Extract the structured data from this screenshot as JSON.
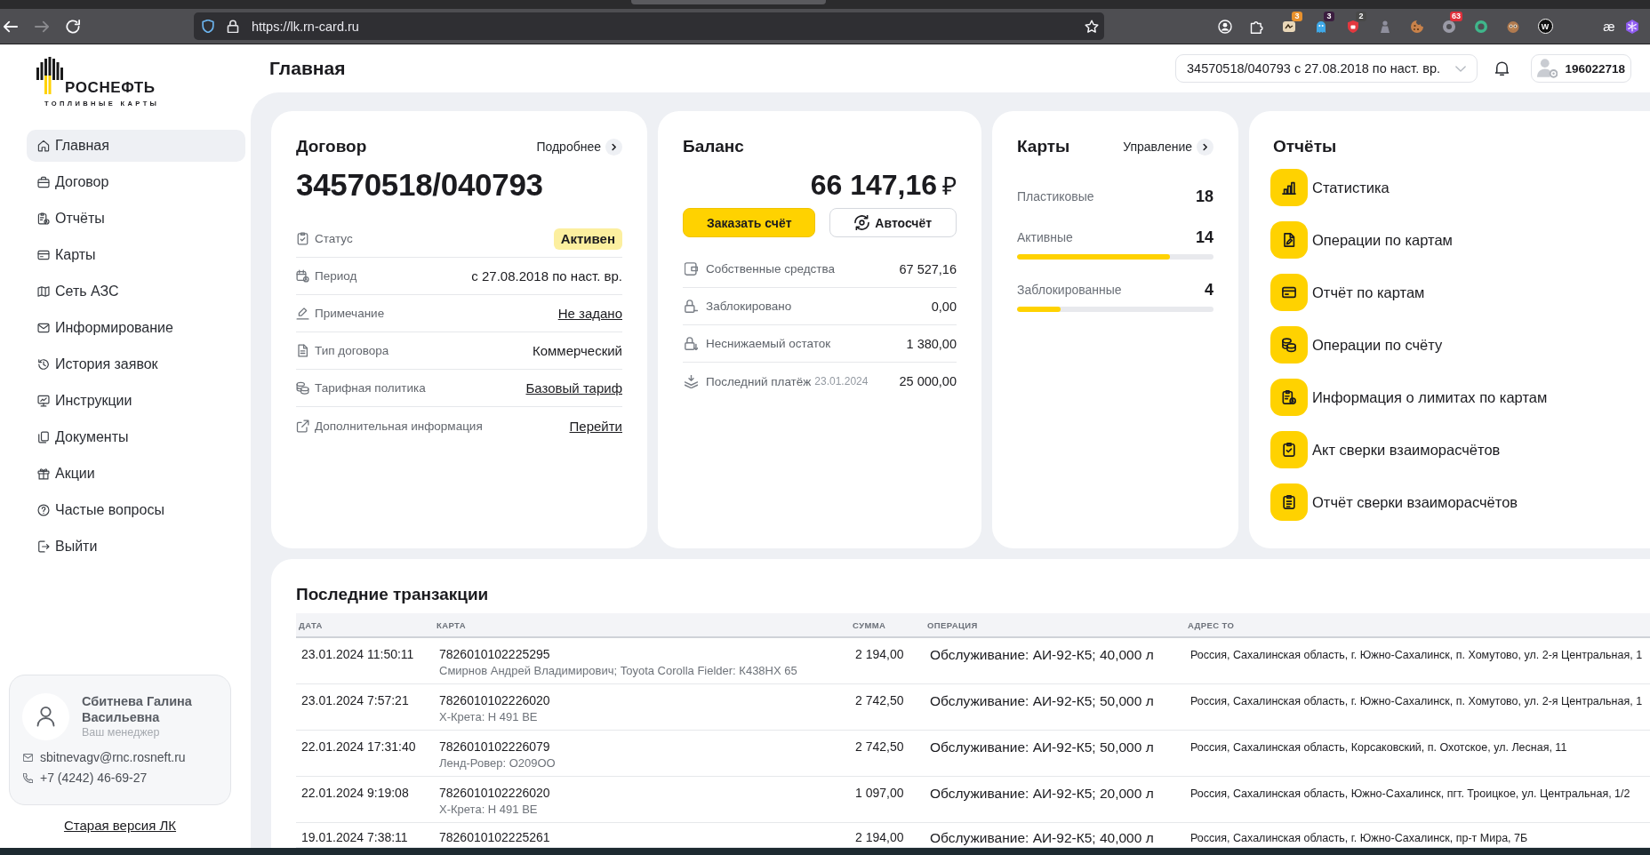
{
  "browser": {
    "url": "https://lk.rn-card.ru",
    "badges": [
      {
        "text": "3",
        "color": "#e8912d"
      },
      {
        "text": "3",
        "color": "#3b1d3f"
      },
      {
        "text": "2",
        "color": "#484848"
      },
      {
        "text": "63",
        "color": "#e0303b"
      }
    ],
    "letter_buttons": [
      "W",
      "æ"
    ]
  },
  "logo": {
    "name": "РОСНЕФТЬ",
    "tagline": "ТОПЛИВНЫЕ КАРТЫ"
  },
  "header": {
    "title": "Главная",
    "contract_selector": "34570518/040793 с 27.08.2018 по наст. вр.",
    "user_id": "196022718"
  },
  "sidebar": {
    "items": [
      {
        "label": "Главная",
        "selected": true
      },
      {
        "label": "Договор",
        "selected": false
      },
      {
        "label": "Отчёты",
        "selected": false
      },
      {
        "label": "Карты",
        "selected": false
      },
      {
        "label": "Сеть АЗС",
        "selected": false
      },
      {
        "label": "Информирование",
        "selected": false
      },
      {
        "label": "История заявок",
        "selected": false
      },
      {
        "label": "Инструкции",
        "selected": false
      },
      {
        "label": "Документы",
        "selected": false
      },
      {
        "label": "Акции",
        "selected": false
      },
      {
        "label": "Частые вопросы",
        "selected": false
      },
      {
        "label": "Выйти",
        "selected": false
      }
    ],
    "manager": {
      "name": "Сбитнева Галина Васильевна",
      "role": "Ваш менеджер",
      "email": "sbitnevagv@rnc.rosneft.ru",
      "phone": "+7 (4242) 46-69-27"
    },
    "old_version_link": "Старая версия ЛК"
  },
  "contract": {
    "title": "Договор",
    "details_link": "Подробнее",
    "number": "34570518/040793",
    "rows": [
      {
        "label": "Статус",
        "value": "Активен",
        "kind": "badge"
      },
      {
        "label": "Период",
        "value": "с 27.08.2018 по наст. вр.",
        "kind": "text"
      },
      {
        "label": "Примечание",
        "value": "Не задано",
        "kind": "link"
      },
      {
        "label": "Тип договора",
        "value": "Коммерческий",
        "kind": "text"
      },
      {
        "label": "Тарифная политика",
        "value": "Базовый тариф",
        "kind": "link"
      },
      {
        "label": "Дополнительная информация",
        "value": "Перейти",
        "kind": "link"
      }
    ]
  },
  "balance": {
    "title": "Баланс",
    "amount": "66 147,16",
    "currency": "₽",
    "buttons": [
      {
        "label": "Заказать счёт",
        "kind": "primary"
      },
      {
        "label": "Автосчёт",
        "kind": "secondary"
      }
    ],
    "rows": [
      {
        "label": "Собственные средства",
        "value": "67 527,16"
      },
      {
        "label": "Заблокировано",
        "value": "0,00"
      },
      {
        "label": "Неснижаемый остаток",
        "value": "1 380,00"
      },
      {
        "label": "Последний платёж",
        "date": "23.01.2024",
        "value": "25 000,00"
      }
    ]
  },
  "cards": {
    "title": "Карты",
    "manage_link": "Управление",
    "rows": [
      {
        "label": "Пластиковые",
        "count": "18"
      },
      {
        "label": "Активные",
        "count": "14",
        "level": 0.78
      },
      {
        "label": "Заблокированные",
        "count": "4",
        "level": 0.22
      }
    ]
  },
  "reports": {
    "title": "Отчёты",
    "items": [
      "Статистика",
      "Операции по картам",
      "Отчёт по картам",
      "Операции по счёту",
      "Информация о лимитах по картам",
      "Акт сверки взаиморасчётов",
      "Отчёт сверки взаиморасчётов"
    ]
  },
  "transactions": {
    "title": "Последние транзакции",
    "columns": [
      "ДАТА",
      "КАРТА",
      "СУММА",
      "ОПЕРАЦИЯ",
      "АДРЕС ТО"
    ],
    "rows": [
      {
        "date": "23.01.2024 11:50:11",
        "card": "7826010102225295",
        "holder": "Смирнов Андрей Владимирович; Toyota Corolla Fielder: К438НХ 65",
        "amount": "2 194,00",
        "operation": "Обслуживание: АИ-92-К5; 40,000 л",
        "address": "Россия, Сахалинская область, г. Южно-Сахалинск, п. Хомутово, ул. 2-я Центральная, 1"
      },
      {
        "date": "23.01.2024 7:57:21",
        "card": "7826010102226020",
        "holder": "Х-Крета: Н 491 ВЕ",
        "amount": "2 742,50",
        "operation": "Обслуживание: АИ-92-К5; 50,000 л",
        "address": "Россия, Сахалинская область, г. Южно-Сахалинск, п. Хомутово, ул. 2-я Центральная, 1"
      },
      {
        "date": "22.01.2024 17:31:40",
        "card": "7826010102226079",
        "holder": "Ленд-Ровер: О209ОО",
        "amount": "2 742,50",
        "operation": "Обслуживание: АИ-92-К5; 50,000 л",
        "address": "Россия, Сахалинская область, Корсаковский, п. Охотское, ул. Лесная, 11"
      },
      {
        "date": "22.01.2024 9:19:08",
        "card": "7826010102226020",
        "holder": "Х-Крета: Н 491 ВЕ",
        "amount": "1 097,00",
        "operation": "Обслуживание: АИ-92-К5; 20,000 л",
        "address": "Россия, Сахалинская область, Южно-Сахалинск, пгт. Троицкое, ул. Центральная, 1/2"
      },
      {
        "date": "19.01.2024 7:38:11",
        "card": "7826010102225261",
        "amount": "2 194,00",
        "operation": "Обслуживание: АИ-92-К5; 40,000 л",
        "address": "Россия, Сахалинская область, г. Южно-Сахалинск, пр-т Мира, 7Б"
      }
    ]
  }
}
